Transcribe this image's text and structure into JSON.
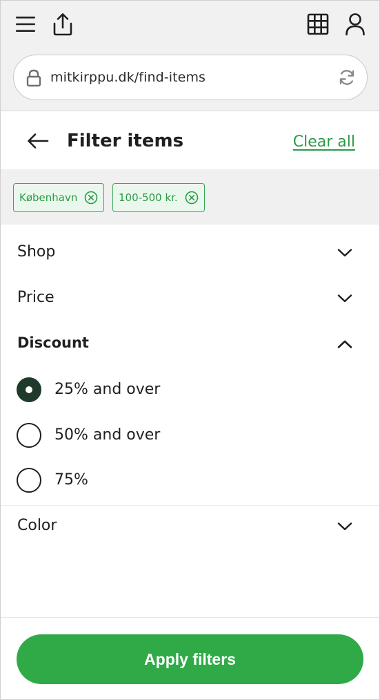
{
  "browser": {
    "url": "mitkirppu.dk/find-items",
    "icons": [
      "menu-icon",
      "share-icon",
      "grid-icon",
      "user-icon",
      "lock-icon",
      "reload-icon"
    ]
  },
  "header": {
    "title": "Filter items",
    "clear_all": "Clear all"
  },
  "active_filters": [
    {
      "label": "København"
    },
    {
      "label": "100-500 kr."
    }
  ],
  "sections": {
    "shop": {
      "label": "Shop",
      "expanded": false
    },
    "price": {
      "label": "Price",
      "expanded": false
    },
    "discount": {
      "label": "Discount",
      "expanded": true,
      "options": [
        {
          "label": "25% and over",
          "selected": true
        },
        {
          "label": "50% and over",
          "selected": false
        },
        {
          "label": "75%",
          "selected": false
        }
      ]
    },
    "color": {
      "label": "Color",
      "expanded": false
    }
  },
  "footer": {
    "apply_label": "Apply filters"
  },
  "colors": {
    "accent": "#2faa47",
    "chip_border": "#39a853",
    "chip_bg": "#eaf7ec",
    "radio_selected": "#1f3a2b"
  }
}
